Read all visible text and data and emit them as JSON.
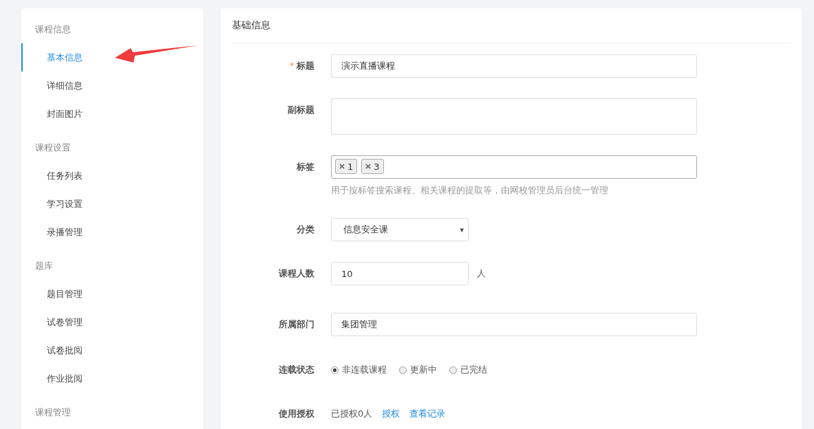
{
  "sidebar": {
    "groups": [
      {
        "title": "课程信息",
        "items": [
          {
            "label": "基本信息",
            "selected": true
          },
          {
            "label": "详细信息",
            "selected": false
          },
          {
            "label": "封面图片",
            "selected": false
          }
        ]
      },
      {
        "title": "课程设置",
        "items": [
          {
            "label": "任务列表",
            "selected": false
          },
          {
            "label": "学习设置",
            "selected": false
          },
          {
            "label": "录播管理",
            "selected": false
          }
        ]
      },
      {
        "title": "题库",
        "items": [
          {
            "label": "题目管理",
            "selected": false
          },
          {
            "label": "试卷管理",
            "selected": false
          },
          {
            "label": "试卷批阅",
            "selected": false
          },
          {
            "label": "作业批阅",
            "selected": false
          }
        ]
      },
      {
        "title": "课程管理"
      }
    ]
  },
  "panel": {
    "title": "基础信息",
    "required_mark": "*",
    "fields": [
      {
        "kind": "text",
        "label": "标题",
        "required": true,
        "value": "演示直播课程"
      },
      {
        "kind": "textarea",
        "label": "副标题",
        "required": false
      },
      {
        "kind": "tags",
        "label": "标签",
        "required": false,
        "tags": [
          "1",
          "3"
        ],
        "help": "用于按标签搜索课程、相关课程的提取等，由网校管理员后台统一管理"
      },
      {
        "kind": "select",
        "label": "分类",
        "required": false,
        "value": "信息安全课",
        "caret": "▾"
      },
      {
        "kind": "number",
        "label": "课程人数",
        "required": false,
        "value": "10",
        "unit": "人"
      },
      {
        "kind": "text",
        "label": "所属部门",
        "required": false,
        "value": "集团管理"
      },
      {
        "kind": "radio",
        "label": "连载状态",
        "required": false,
        "options": [
          {
            "label": "非连载课程",
            "selected": true
          },
          {
            "label": "更新中",
            "selected": false
          },
          {
            "label": "已完结",
            "selected": false
          }
        ]
      },
      {
        "kind": "auth",
        "label": "使用授权",
        "required": false,
        "text": "已授权0人",
        "links": [
          "授权",
          "查看记录"
        ]
      }
    ]
  }
}
